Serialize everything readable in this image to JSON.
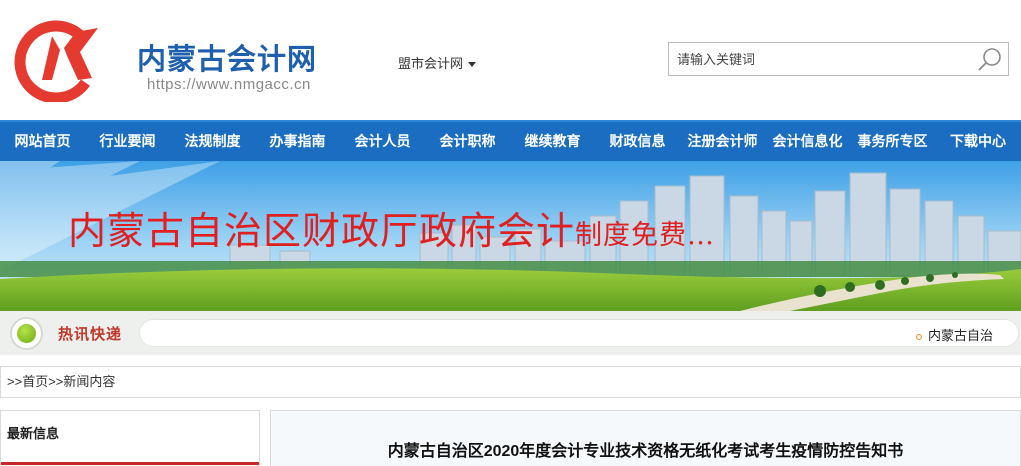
{
  "header": {
    "site_name": "内蒙古会计网",
    "site_url": "https://www.nmgacc.cn",
    "city_select": "盟市会计网",
    "search_placeholder": "请输入关键词",
    "logo_color": "#e53a2f",
    "brand_color": "#1e5fae"
  },
  "nav": {
    "items": [
      "网站首页",
      "行业要闻",
      "法规制度",
      "办事指南",
      "会计人员",
      "会计职称",
      "继续教育",
      "财政信息",
      "注册会计师",
      "会计信息化",
      "事务所专区",
      "下载中心"
    ],
    "bg_color": "#1a6dc1"
  },
  "banner": {
    "title_main": "内蒙古自治区财政厅政府会计",
    "title_tail": "制度免费…"
  },
  "ticker": {
    "label": "热讯快递",
    "items": [
      "内蒙古自治"
    ]
  },
  "breadcrumb": {
    "prefix": ">>",
    "home": "首页",
    "sep": ">>",
    "current": "新闻内容"
  },
  "sidebar": {
    "title": "最新信息"
  },
  "article": {
    "title": "内蒙古自治区2020年度会计专业技术资格无纸化考试考生疫情防控告知书"
  }
}
